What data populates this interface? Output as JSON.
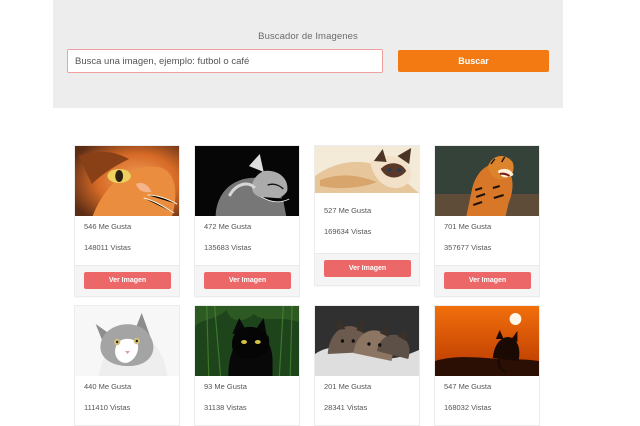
{
  "search": {
    "title": "Buscador de Imagenes",
    "placeholder": "Busca una imagen, ejemplo: futbol o café",
    "button_label": "Buscar"
  },
  "results": [
    {
      "likes": "546 Me Gusta",
      "views": "148011 Vistas",
      "button_label": "Ver Imagen",
      "image_icon": "orange-cat-close-up-icon"
    },
    {
      "likes": "472 Me Gusta",
      "views": "135683 Vistas",
      "button_label": "Ver Imagen",
      "image_icon": "gray-cat-looking-up-icon"
    },
    {
      "likes": "527 Me Gusta",
      "views": "169634 Vistas",
      "button_label": "Ver Imagen",
      "image_icon": "siamese-cat-lying-icon"
    },
    {
      "likes": "701 Me Gusta",
      "views": "357677 Vistas",
      "button_label": "Ver Imagen",
      "image_icon": "tiger-roaring-icon"
    },
    {
      "likes": "440 Me Gusta",
      "views": "111410 Vistas",
      "image_icon": "gray-white-cat-icon"
    },
    {
      "likes": "93 Me Gusta",
      "views": "31138 Vistas",
      "image_icon": "black-cat-grass-icon"
    },
    {
      "likes": "201 Me Gusta",
      "views": "28341 Vistas",
      "image_icon": "kittens-blanket-icon"
    },
    {
      "likes": "547 Me Gusta",
      "views": "168032 Vistas",
      "image_icon": "cat-sunset-silhouette-icon"
    }
  ]
}
